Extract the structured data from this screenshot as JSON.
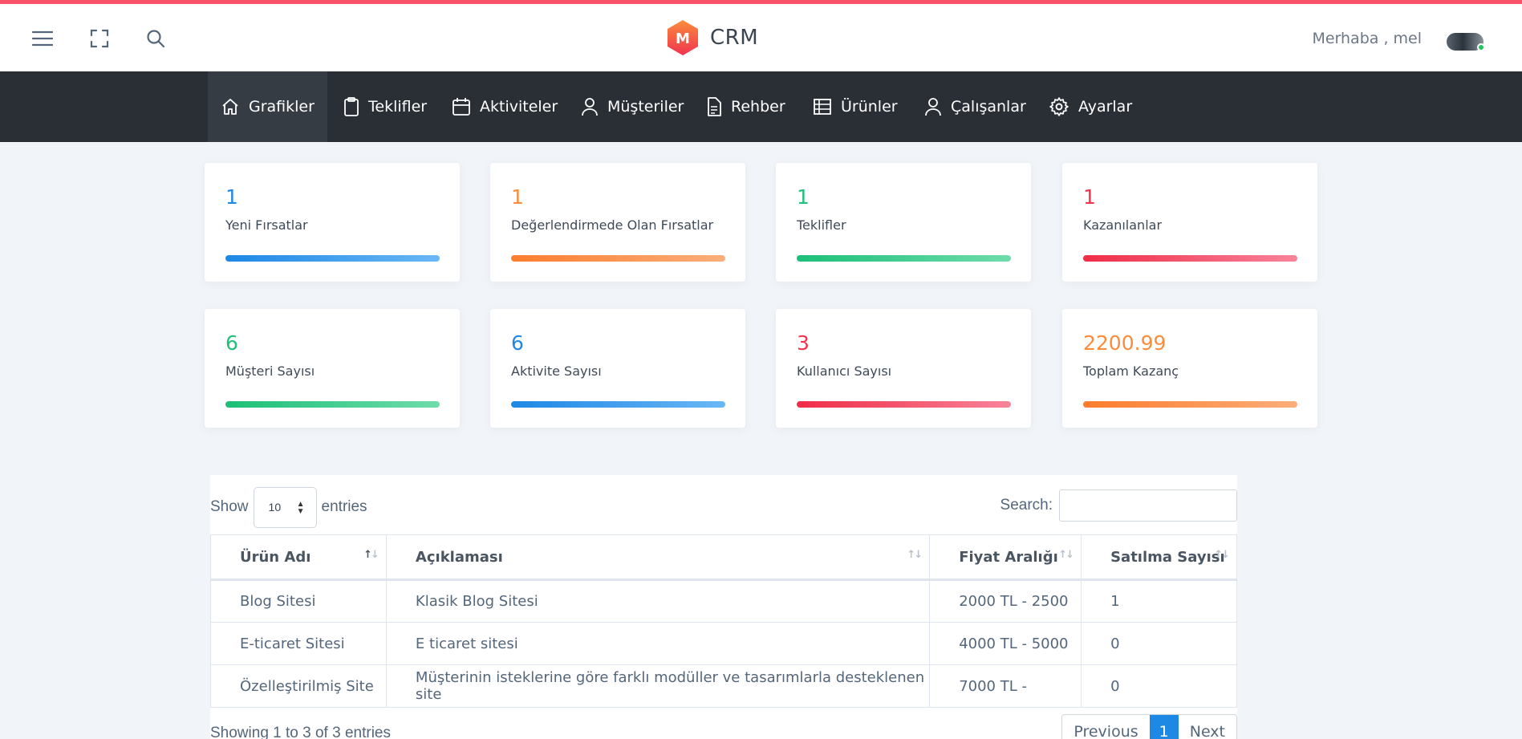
{
  "header": {
    "brand_letter": "M",
    "brand_name": "CRM",
    "greeting": "Merhaba , mel",
    "icons": [
      "menu-icon",
      "fullscreen-icon",
      "search-icon"
    ]
  },
  "nav": {
    "items": [
      {
        "label": "Grafikler",
        "icon": "home-icon",
        "active": true
      },
      {
        "label": "Teklifler",
        "icon": "clipboard-icon"
      },
      {
        "label": "Aktiviteler",
        "icon": "calendar-icon"
      },
      {
        "label": "Müşteriler",
        "icon": "user-icon"
      },
      {
        "label": "Rehber",
        "icon": "document-icon"
      },
      {
        "label": "Ürünler",
        "icon": "table-icon"
      },
      {
        "label": "Çalışanlar",
        "icon": "user-icon"
      },
      {
        "label": "Ayarlar",
        "icon": "gear-icon"
      }
    ]
  },
  "stats": [
    {
      "value": "1",
      "label": "Yeni Fırsatlar",
      "color": "#1e88e5"
    },
    {
      "value": "1",
      "label": "Değerlendirmede Olan Fırsatlar",
      "color": "#fb8c3c"
    },
    {
      "value": "1",
      "label": "Teklifler",
      "color": "#21c07a"
    },
    {
      "value": "1",
      "label": "Kazanılanlar",
      "color": "#f0344f"
    },
    {
      "value": "6",
      "label": "Müşteri Sayısı",
      "color": "#21c07a"
    },
    {
      "value": "6",
      "label": "Aktivite Sayısı",
      "color": "#1e88e5"
    },
    {
      "value": "3",
      "label": "Kullanıcı Sayısı",
      "color": "#f0344f"
    },
    {
      "value": "2200.99",
      "label": "Toplam Kazanç",
      "color": "#fb8c3c"
    }
  ],
  "table": {
    "show_label": "Show",
    "entries_value": "10",
    "entries_label": "entries",
    "search_label": "Search:",
    "search_value": "",
    "columns": [
      "Ürün Adı",
      "Açıklaması",
      "Fiyat Aralığı",
      "Satılma Sayısı"
    ],
    "rows": [
      [
        "Blog Sitesi",
        "Klasik Blog Sitesi",
        "2000 TL - 2500",
        "1"
      ],
      [
        "E-ticaret Sitesi",
        "E ticaret sitesi",
        "4000 TL - 5000",
        "0"
      ],
      [
        "Özelleştirilmiş Site",
        "Müşterinin isteklerine göre farklı modüller ve tasarımlarla desteklenen site",
        "7000 TL -",
        "0"
      ]
    ],
    "info": "Showing 1 to 3 of 3 entries",
    "pager": {
      "previous": "Previous",
      "current": "1",
      "next": "Next"
    }
  }
}
